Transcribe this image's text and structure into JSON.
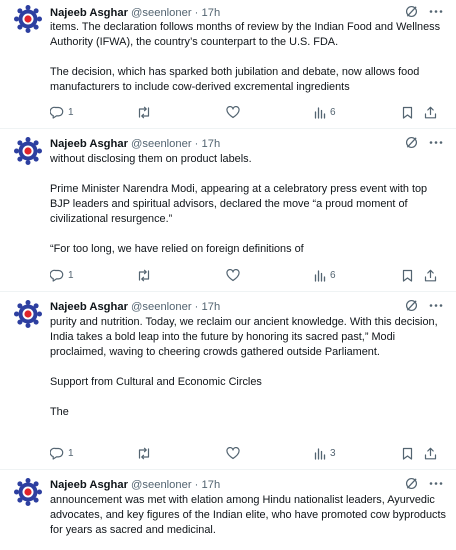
{
  "author": {
    "name": "Najeeb Asghar",
    "handle": "@seenloner",
    "time": "17h"
  },
  "tweets": [
    {
      "paragraphs": [
        "items. The declaration follows months of review by the Indian Food and Wellness Authority (IFWA), the country’s counterpart to the U.S. FDA.",
        "The decision, which has sparked both jubilation and debate, now allows food manufacturers to include cow-derived excremental ingredients"
      ],
      "replies": "1",
      "views": "6"
    },
    {
      "paragraphs": [
        "without disclosing them on product labels.",
        "Prime Minister Narendra Modi, appearing at a celebratory press event with top BJP leaders and spiritual advisors, declared the move “a proud moment of civilizational resurgence.”",
        "“For too long, we have relied on foreign definitions of"
      ],
      "replies": "1",
      "views": "6"
    },
    {
      "paragraphs": [
        "purity and nutrition. Today, we reclaim our ancient knowledge. With this decision, India takes a bold leap into the future by honoring its sacred past,” Modi proclaimed, waving to cheering crowds gathered outside Parliament.",
        "Support from Cultural and Economic Circles",
        "The"
      ],
      "replies": "1",
      "views": "3"
    },
    {
      "paragraphs": [
        "announcement was met with elation among Hindu nationalist leaders, Ayurvedic advocates, and key figures of the Indian elite, who have promoted cow byproducts for years as sacred and medicinal."
      ]
    }
  ]
}
